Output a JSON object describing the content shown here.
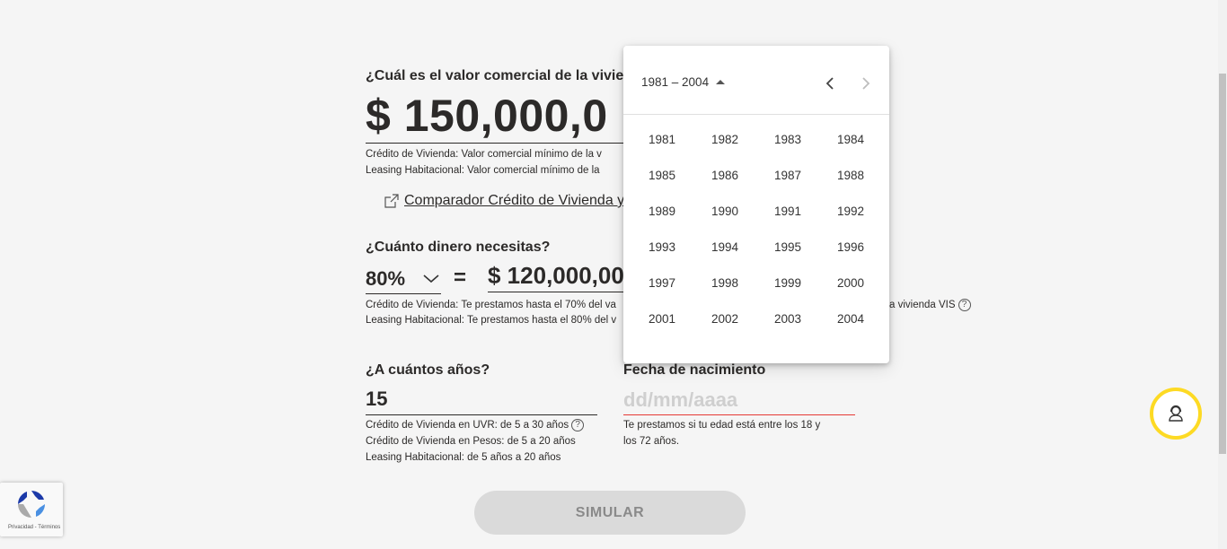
{
  "property_value": {
    "question": "¿Cuál es el valor comercial de la vivien",
    "value": "$ 150,000,0",
    "hint_line1": "Crédito de Vivienda: Valor comercial mínimo de la v",
    "hint_line2": "Leasing Habitacional: Valor comercial mínimo de la"
  },
  "comparator_link": {
    "label": "Comparador Crédito de Vivienda y"
  },
  "loan_amount": {
    "question": "¿Cuánto dinero necesitas?",
    "percent": "80%",
    "equals": "=",
    "amount": "$ 120,000,00",
    "hint_line1": "Crédito de Vivienda: Te prestamos hasta el 70% del va",
    "hint_line1_tail": "a vivienda VIS",
    "hint_line2": "Leasing Habitacional: Te prestamos hasta el 80% del v"
  },
  "term": {
    "question": "¿A cuántos años?",
    "value": "15",
    "hint_line1": "Crédito de Vivienda en UVR: de 5 a 30 años",
    "hint_line2": "Crédito de Vivienda en Pesos: de 5 a 20 años",
    "hint_line3": "Leasing Habitacional: de 5 años a 20 años"
  },
  "birth_date": {
    "label": "Fecha de nacimiento",
    "placeholder": "dd/mm/aaaa",
    "hint_line1": "Te prestamos si tu edad está entre los 18 y",
    "hint_line2": "los 72 años."
  },
  "simulate_button": {
    "label": "SIMULAR"
  },
  "date_picker": {
    "range_label": "1981 – 2004",
    "years": [
      [
        "1981",
        "1982",
        "1983",
        "1984"
      ],
      [
        "1985",
        "1986",
        "1987",
        "1988"
      ],
      [
        "1989",
        "1990",
        "1991",
        "1992"
      ],
      [
        "1993",
        "1994",
        "1995",
        "1996"
      ],
      [
        "1997",
        "1998",
        "1999",
        "2000"
      ],
      [
        "2001",
        "2002",
        "2003",
        "2004"
      ]
    ]
  },
  "recaptcha": {
    "links": "Privacidad - Términos"
  },
  "icons": {
    "external_link": "external-link-icon",
    "chevron_down": "chevron-down-icon",
    "help": "help-icon",
    "assistant": "assistant-icon",
    "recaptcha": "recaptcha-icon"
  },
  "colors": {
    "background": "#f5f5f5",
    "text": "#2c2a29",
    "error_underline": "#e53935",
    "assistant_ring": "#fdda24",
    "button_disabled": "#dadada"
  },
  "help_glyph": "?"
}
